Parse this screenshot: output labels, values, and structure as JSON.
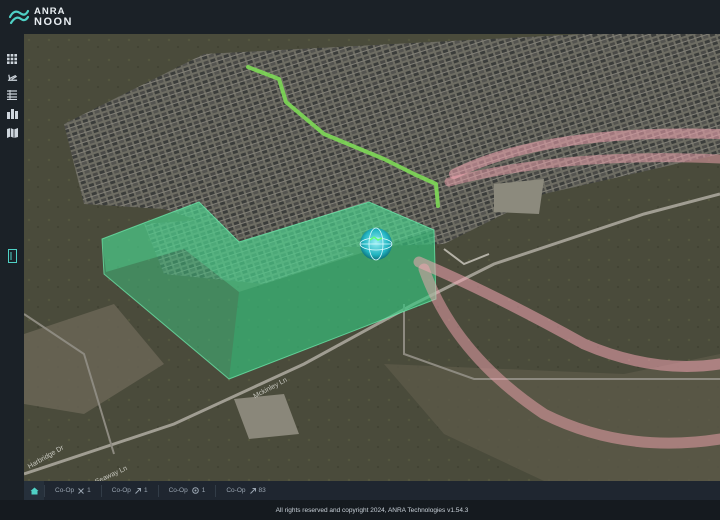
{
  "app": {
    "logo_line1": "ANRA",
    "logo_line2": "NOON"
  },
  "sidebar": {
    "items": [
      {
        "icon": "grid-icon"
      },
      {
        "icon": "airplane-icon"
      },
      {
        "icon": "list-icon"
      },
      {
        "icon": "building-icon"
      },
      {
        "icon": "map-icon"
      }
    ],
    "panel_toggle_icon": "panel-toggle-icon"
  },
  "map": {
    "street_labels": [
      "Mckinley Ln",
      "Harbridge Dr",
      "Seaway Ln"
    ],
    "route_color": "#7ed957",
    "zone_color": "#3fd28a",
    "corridor_color": "#f3a6b2"
  },
  "statusbar": {
    "items": [
      {
        "label": "Co-Op",
        "icon": "close-icon",
        "value": "1"
      },
      {
        "label": "Co-Op",
        "icon": "expand-icon",
        "value": "1"
      },
      {
        "label": "Co-Op",
        "icon": "target-icon",
        "value": "1"
      },
      {
        "label": "Co-Op",
        "icon": "expand-icon",
        "value": "83"
      }
    ]
  },
  "footer": {
    "copyright": "All rights reserved and copyright 2024, ANRA Technologies v1.54.3"
  }
}
